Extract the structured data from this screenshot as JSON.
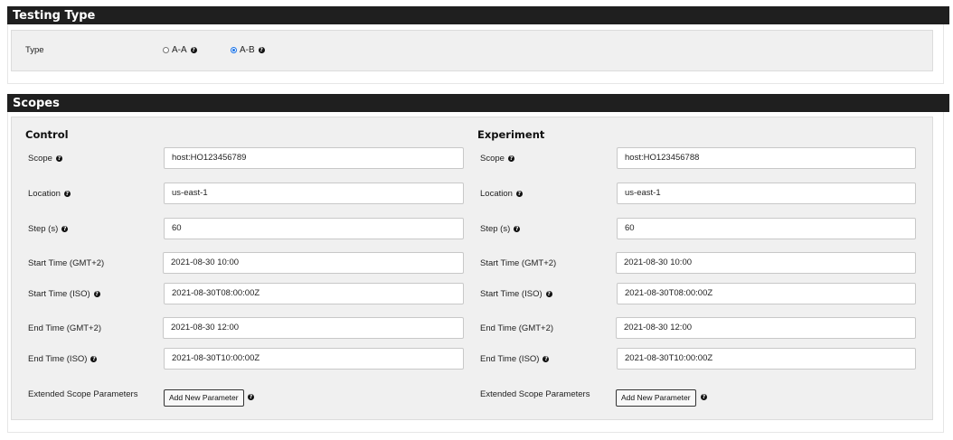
{
  "testing_type": {
    "title": "Testing Type",
    "type_label": "Type",
    "options": [
      {
        "label": "A-A",
        "selected": false
      },
      {
        "label": "A-B",
        "selected": true
      }
    ]
  },
  "scopes": {
    "title": "Scopes",
    "labels": {
      "scope": "Scope",
      "location": "Location",
      "step": "Step (s)",
      "start_time_local": "Start Time (GMT+2)",
      "start_time_iso": "Start Time (ISO)",
      "end_time_local": "End Time (GMT+2)",
      "end_time_iso": "End Time (ISO)",
      "extended": "Extended Scope Parameters"
    },
    "add_parameter_label": "Add New Parameter",
    "control": {
      "title": "Control",
      "scope": "host:HO123456789",
      "location": "us-east-1",
      "step": "60",
      "start_time_local": "2021-08-30 10:00",
      "start_time_iso": "2021-08-30T08:00:00Z",
      "end_time_local": "2021-08-30 12:00",
      "end_time_iso": "2021-08-30T10:00:00Z"
    },
    "experiment": {
      "title": "Experiment",
      "scope": "host:HO123456788",
      "location": "us-east-1",
      "step": "60",
      "start_time_local": "2021-08-30 10:00",
      "start_time_iso": "2021-08-30T08:00:00Z",
      "end_time_local": "2021-08-30 12:00",
      "end_time_iso": "2021-08-30T10:00:00Z"
    }
  },
  "icons": {
    "help": "question-circle-icon"
  },
  "colors": {
    "header_bg": "#1f1f1f",
    "panel_bg": "#f0f0f0",
    "radio_accent": "#1a73e8"
  }
}
